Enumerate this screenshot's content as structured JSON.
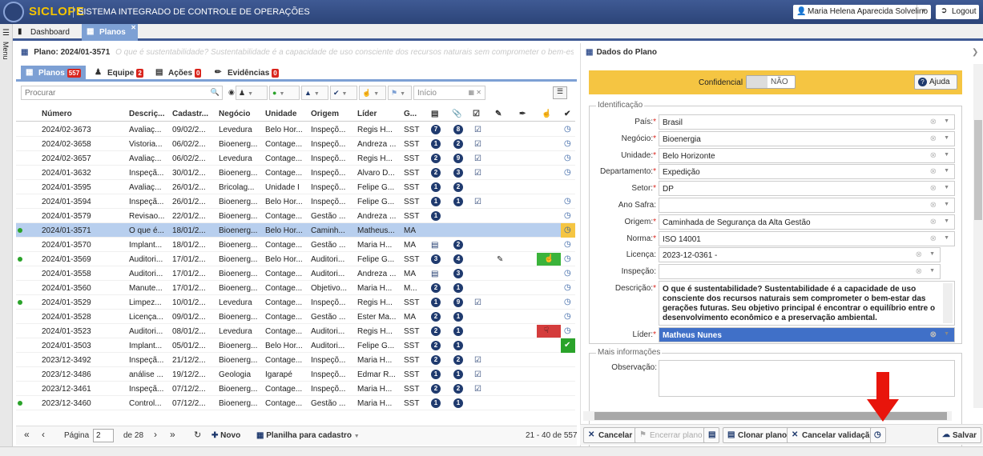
{
  "app": {
    "brand": "SICLOPE",
    "subtitle": "SISTEMA INTEGRADO DE CONTROLE DE OPERAÇÕES",
    "user": "Maria Helena Aparecida Solvelino",
    "logout": "Logout",
    "menu": "Menu"
  },
  "tabs": [
    {
      "label": "Dashboard"
    },
    {
      "label": "Planos"
    }
  ],
  "plan": {
    "title": "Plano: 2024/01-3571",
    "description_preview": "O que é sustentabilidade? Sustentabilidade é a capacidade de uso consciente dos recursos naturais sem comprometer o bem-estar das gerações futuras. Seu obje"
  },
  "subtabs": [
    {
      "label": "Planos",
      "badge": "557"
    },
    {
      "label": "Equipe",
      "badge": "2"
    },
    {
      "label": "Ações",
      "badge": "0"
    },
    {
      "label": "Evidências",
      "badge": "0"
    }
  ],
  "toolbar": {
    "search_placeholder": "Procurar",
    "date_placeholder": "Início"
  },
  "columns": [
    "Número",
    "Descriç...",
    "Cadastr...",
    "Negócio",
    "Unidade",
    "Origem",
    "Líder",
    "G..."
  ],
  "rows": [
    {
      "num": "2024/02-3673",
      "desc": "Avaliaç...",
      "cad": "09/02/2...",
      "neg": "Levedura",
      "uni": "Belo Hor...",
      "ori": "Inspeçõ...",
      "lid": "Regis H...",
      "g": "SST",
      "a": "7",
      "b": "8",
      "chk": true,
      "clip": false,
      "dot": false,
      "like": "",
      "status": "clock"
    },
    {
      "num": "2024/02-3658",
      "desc": "Vistoria...",
      "cad": "06/02/2...",
      "neg": "Bioenerg...",
      "uni": "Contage...",
      "ori": "Inspeçõ...",
      "lid": "Andreza ...",
      "g": "SST",
      "a": "1",
      "b": "2",
      "chk": true,
      "clip": false,
      "dot": false,
      "like": "",
      "status": "clock"
    },
    {
      "num": "2024/02-3657",
      "desc": "Avaliaç...",
      "cad": "06/02/2...",
      "neg": "Levedura",
      "uni": "Contage...",
      "ori": "Inspeçõ...",
      "lid": "Regis H...",
      "g": "SST",
      "a": "2",
      "b": "9",
      "chk": true,
      "clip": false,
      "dot": false,
      "like": "",
      "status": "clock"
    },
    {
      "num": "2024/01-3632",
      "desc": "Inspeçã...",
      "cad": "30/01/2...",
      "neg": "Bioenerg...",
      "uni": "Contage...",
      "ori": "Inspeçõ...",
      "lid": "Alvaro D...",
      "g": "SST",
      "a": "2",
      "b": "3",
      "chk": true,
      "clip": false,
      "dot": false,
      "like": "",
      "status": "clock"
    },
    {
      "num": "2024/01-3595",
      "desc": "Avaliaç...",
      "cad": "26/01/2...",
      "neg": "Bricolag...",
      "uni": "Unidade I",
      "ori": "Inspeçõ...",
      "lid": "Felipe G...",
      "g": "SST",
      "a": "1",
      "b": "2",
      "chk": false,
      "clip": false,
      "dot": false,
      "like": "",
      "status": ""
    },
    {
      "num": "2024/01-3594",
      "desc": "Inspeçã...",
      "cad": "26/01/2...",
      "neg": "Bioenerg...",
      "uni": "Belo Hor...",
      "ori": "Inspeçõ...",
      "lid": "Felipe G...",
      "g": "SST",
      "a": "1",
      "b": "1",
      "chk": true,
      "clip": false,
      "dot": false,
      "like": "",
      "status": "clock"
    },
    {
      "num": "2024/01-3579",
      "desc": "Revisao...",
      "cad": "22/01/2...",
      "neg": "Bioenerg...",
      "uni": "Contage...",
      "ori": "Gestão ...",
      "lid": "Andreza ...",
      "g": "SST",
      "a": "1",
      "b": "",
      "chk": false,
      "clip": false,
      "dot": false,
      "like": "",
      "status": "clock"
    },
    {
      "num": "2024/01-3571",
      "desc": "O que é...",
      "cad": "18/01/2...",
      "neg": "Bioenerg...",
      "uni": "Belo Hor...",
      "ori": "Caminh...",
      "lid": "Matheus...",
      "g": "MA",
      "a": "",
      "b": "",
      "chk": false,
      "clip": false,
      "dot": true,
      "like": "",
      "status": "clock-yellow",
      "sel": true
    },
    {
      "num": "2024/01-3570",
      "desc": "Implant...",
      "cad": "18/01/2...",
      "neg": "Bioenerg...",
      "uni": "Contage...",
      "ori": "Gestão ...",
      "lid": "Maria H...",
      "g": "MA",
      "a": "",
      "b": "2",
      "chk": false,
      "clip": true,
      "dot": false,
      "like": "",
      "status": "clock"
    },
    {
      "num": "2024/01-3569",
      "desc": "Auditori...",
      "cad": "17/01/2...",
      "neg": "Bioenerg...",
      "uni": "Belo Hor...",
      "ori": "Auditori...",
      "lid": "Felipe G...",
      "g": "SST",
      "a": "3",
      "b": "4",
      "chk": false,
      "clip": false,
      "dot": true,
      "like": "up",
      "status": "clock"
    },
    {
      "num": "2024/01-3558",
      "desc": "Auditori...",
      "cad": "17/01/2...",
      "neg": "Bioenerg...",
      "uni": "Contage...",
      "ori": "Auditori...",
      "lid": "Andreza ...",
      "g": "MA",
      "a": "",
      "b": "3",
      "chk": false,
      "clip": true,
      "dot": false,
      "like": "",
      "status": "clock"
    },
    {
      "num": "2024/01-3560",
      "desc": "Manute...",
      "cad": "17/01/2...",
      "neg": "Bioenerg...",
      "uni": "Contage...",
      "ori": "Objetivo...",
      "lid": "Maria H...",
      "g": "M...",
      "a": "2",
      "b": "1",
      "chk": false,
      "clip": false,
      "dot": false,
      "like": "",
      "status": "clock"
    },
    {
      "num": "2024/01-3529",
      "desc": "Limpez...",
      "cad": "10/01/2...",
      "neg": "Levedura",
      "uni": "Contage...",
      "ori": "Inspeçõ...",
      "lid": "Regis H...",
      "g": "SST",
      "a": "1",
      "b": "9",
      "chk": true,
      "clip": false,
      "dot": true,
      "like": "",
      "status": "clock"
    },
    {
      "num": "2024/01-3528",
      "desc": "Licença...",
      "cad": "09/01/2...",
      "neg": "Bioenerg...",
      "uni": "Contage...",
      "ori": "Gestão ...",
      "lid": "Ester Ma...",
      "g": "MA",
      "a": "2",
      "b": "1",
      "chk": false,
      "clip": false,
      "dot": false,
      "like": "",
      "status": "clock"
    },
    {
      "num": "2024/01-3523",
      "desc": "Auditori...",
      "cad": "08/01/2...",
      "neg": "Levedura",
      "uni": "Contage...",
      "ori": "Auditori...",
      "lid": "Regis H...",
      "g": "SST",
      "a": "2",
      "b": "1",
      "chk": false,
      "clip": false,
      "dot": false,
      "like": "down",
      "status": "clock"
    },
    {
      "num": "2024/01-3503",
      "desc": "Implant...",
      "cad": "05/01/2...",
      "neg": "Bioenerg...",
      "uni": "Belo Hor...",
      "ori": "Auditori...",
      "lid": "Felipe G...",
      "g": "SST",
      "a": "2",
      "b": "1",
      "chk": false,
      "clip": false,
      "dot": false,
      "like": "",
      "status": "check"
    },
    {
      "num": "2023/12-3492",
      "desc": "Inspeçã...",
      "cad": "21/12/2...",
      "neg": "Bioenerg...",
      "uni": "Contage...",
      "ori": "Inspeçõ...",
      "lid": "Maria H...",
      "g": "SST",
      "a": "2",
      "b": "2",
      "chk": true,
      "clip": false,
      "dot": false,
      "like": "",
      "status": ""
    },
    {
      "num": "2023/12-3486",
      "desc": "análise ...",
      "cad": "19/12/2...",
      "neg": "Geologia",
      "uni": "Igarapé",
      "ori": "Inspeçõ...",
      "lid": "Edmar R...",
      "g": "SST",
      "a": "1",
      "b": "1",
      "chk": true,
      "clip": false,
      "dot": false,
      "like": "",
      "status": ""
    },
    {
      "num": "2023/12-3461",
      "desc": "Inspeçã...",
      "cad": "07/12/2...",
      "neg": "Bioenerg...",
      "uni": "Contage...",
      "ori": "Inspeçõ...",
      "lid": "Maria H...",
      "g": "SST",
      "a": "2",
      "b": "2",
      "chk": true,
      "clip": false,
      "dot": false,
      "like": "",
      "status": ""
    },
    {
      "num": "2023/12-3460",
      "desc": "Control...",
      "cad": "07/12/2...",
      "neg": "Bioenerg...",
      "uni": "Contage...",
      "ori": "Gestão ...",
      "lid": "Maria H...",
      "g": "SST",
      "a": "1",
      "b": "1",
      "chk": false,
      "clip": false,
      "dot": true,
      "like": "",
      "status": ""
    }
  ],
  "pager": {
    "page_label": "Página",
    "page": "2",
    "of": "de 28",
    "new": "Novo",
    "sheet": "Planilha para cadastro",
    "range": "21 - 40 de 557"
  },
  "details": {
    "title": "Dados do Plano",
    "confidential_label": "Confidencial",
    "confidential_value": "NÃO",
    "help": "Ajuda",
    "identification": "Identificação",
    "fields": [
      {
        "label": "País:",
        "req": true,
        "value": "Brasil"
      },
      {
        "label": "Negócio:",
        "req": true,
        "value": "Bioenergia"
      },
      {
        "label": "Unidade:",
        "req": true,
        "value": "Belo Horizonte"
      },
      {
        "label": "Departamento:",
        "req": true,
        "value": "Expedição"
      },
      {
        "label": "Setor:",
        "req": true,
        "value": "DP"
      },
      {
        "label": "Ano Safra:",
        "req": false,
        "value": ""
      },
      {
        "label": "Origem:",
        "req": true,
        "value": "Caminhada de Segurança da Alta Gestão"
      },
      {
        "label": "Norma:",
        "req": true,
        "value": "ISO 14001"
      },
      {
        "label": "Licença:",
        "req": false,
        "value": "2023-12-0361 -"
      },
      {
        "label": "Inspeção:",
        "req": false,
        "value": ""
      }
    ],
    "desc_label": "Descrição:",
    "desc_req": true,
    "desc_value": "O que é sustentabilidade? Sustentabilidade é a capacidade de uso consciente dos recursos naturais sem comprometer o bem-estar das gerações futuras. Seu objetivo principal é encontrar o equilíbrio entre o desenvolvimento econômico e a preservação ambiental.",
    "leader_label": "Líder:",
    "leader_value": "Matheus Nunes",
    "more_info": "Mais informações",
    "obs_label": "Observação:"
  },
  "actions": {
    "cancel": "Cancelar",
    "close": "Encerrar plano",
    "clone": "Clonar plano",
    "cancel_validation": "Cancelar validação",
    "save": "Salvar"
  },
  "colors": {
    "header": "#2c4478",
    "accent": "#7da0d4",
    "confidential": "#f5c542",
    "arrow": "#e8150c"
  }
}
